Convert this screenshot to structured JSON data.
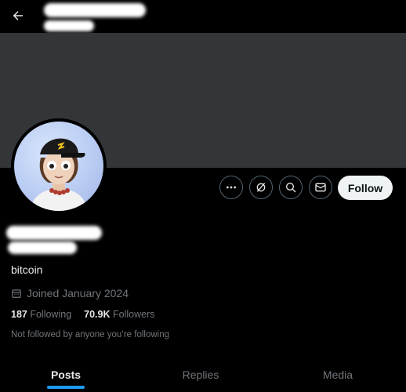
{
  "header": {
    "back_icon": "arrow-left-icon"
  },
  "profile": {
    "username": "bitcoin",
    "joined": "Joined January 2024",
    "following_count": "187",
    "following_label": "Following",
    "followers_count": "70.9K",
    "followers_label": "Followers",
    "not_followed_text": "Not followed by anyone you’re following"
  },
  "actions": {
    "more_icon": "more-icon",
    "grok_icon": "grok-icon",
    "search_icon": "search-icon",
    "message_icon": "mail-icon",
    "follow_label": "Follow"
  },
  "tabs": [
    {
      "label": "Posts",
      "active": true
    },
    {
      "label": "Replies",
      "active": false
    },
    {
      "label": "Media",
      "active": false
    }
  ],
  "colors": {
    "background": "#000000",
    "banner": "#333639",
    "accent": "#1d9bf0",
    "muted_text": "#71767b",
    "follow_button_bg": "#eff3f4"
  }
}
